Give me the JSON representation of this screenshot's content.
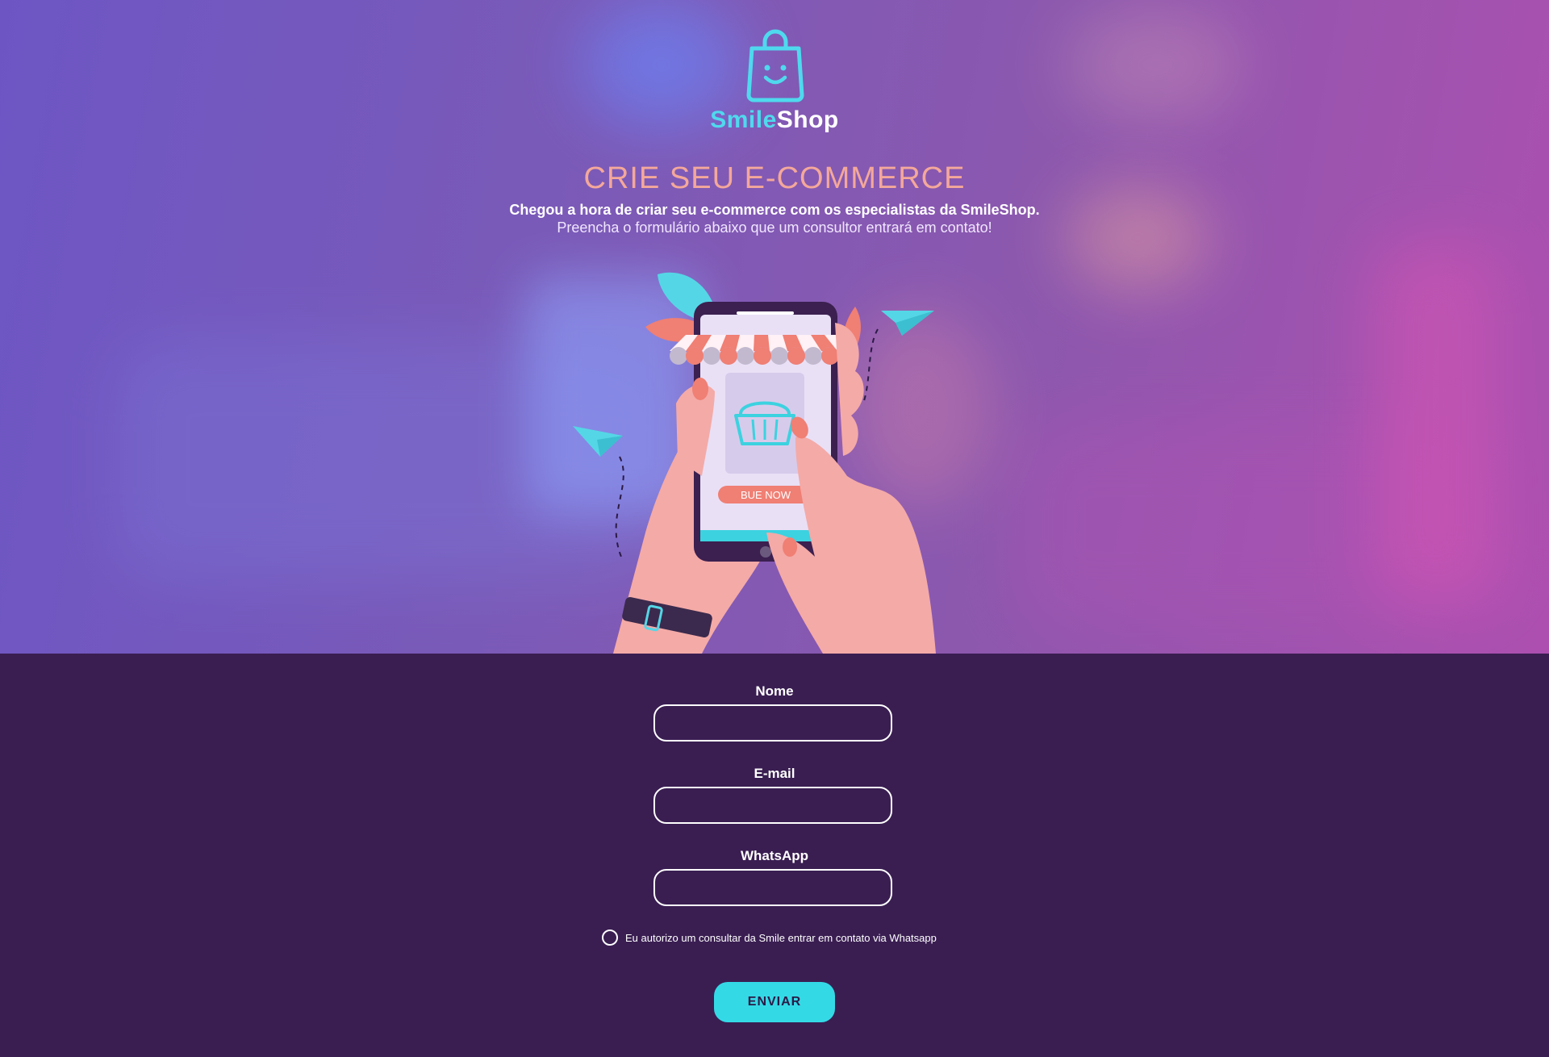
{
  "brand": {
    "name_part1": "Smile",
    "name_part2": "Shop",
    "logo_icon": "smiling-shopping-bag-icon"
  },
  "hero": {
    "headline": "CRIE SEU E-COMMERCE",
    "subtitle_bold": "Chegou a hora de criar seu e-commerce com os especialistas da SmileShop.",
    "subtitle": "Preencha o formulário abaixo que um consultor entrará em contato!",
    "illustration": {
      "button_text": "BUE NOW"
    }
  },
  "form": {
    "name_label": "Nome",
    "email_label": "E-mail",
    "whatsapp_label": "WhatsApp",
    "name_value": "",
    "email_value": "",
    "whatsapp_value": "",
    "consent_text": "Eu autorizo um consultar da Smile entrar em contato via Whatsapp",
    "consent_checked": false,
    "submit_label": "ENVIAR"
  },
  "colors": {
    "accent_cyan": "#34d9e6",
    "headline_coral": "#f4a89a",
    "form_background": "#3a1e52",
    "hero_gradient_start": "#6d56c4",
    "hero_gradient_end": "#ad4fb0"
  }
}
